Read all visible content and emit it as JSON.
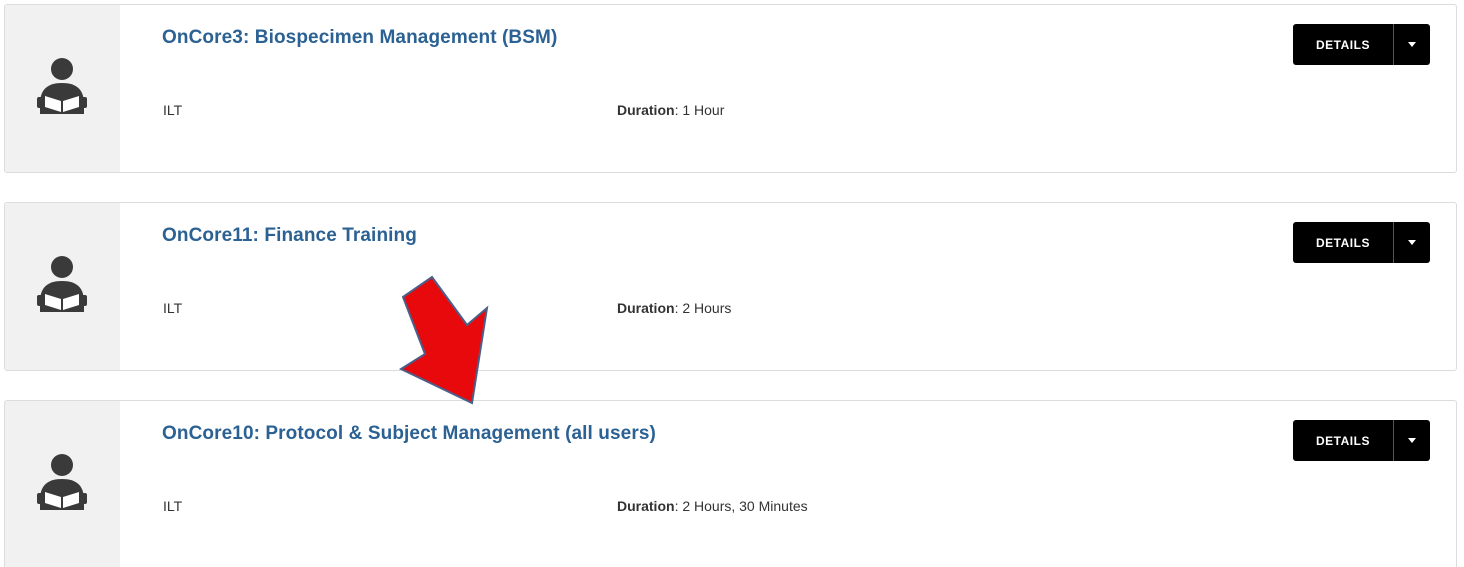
{
  "courses": [
    {
      "title": "OnCore3: Biospecimen Management (BSM)",
      "type": "ILT",
      "duration_label": "Duration",
      "duration_value": ": 1 Hour",
      "details_label": "DETAILS",
      "icon": "reader-icon"
    },
    {
      "title": "OnCore11: Finance Training",
      "type": "ILT",
      "duration_label": "Duration",
      "duration_value": ": 2 Hours",
      "details_label": "DETAILS",
      "icon": "reader-icon"
    },
    {
      "title": "OnCore10: Protocol & Subject Management (all users)",
      "type": "ILT",
      "duration_label": "Duration",
      "duration_value": ": 2 Hours, 30 Minutes",
      "details_label": "DETAILS",
      "icon": "reader-icon"
    }
  ],
  "colors": {
    "title": "#2b6193",
    "button_bg": "#000000",
    "icon_column_bg": "#f1f1f1",
    "annotation_arrow": "#e8090c"
  },
  "annotation": {
    "icon": "red-arrow-pointing-down-left"
  }
}
